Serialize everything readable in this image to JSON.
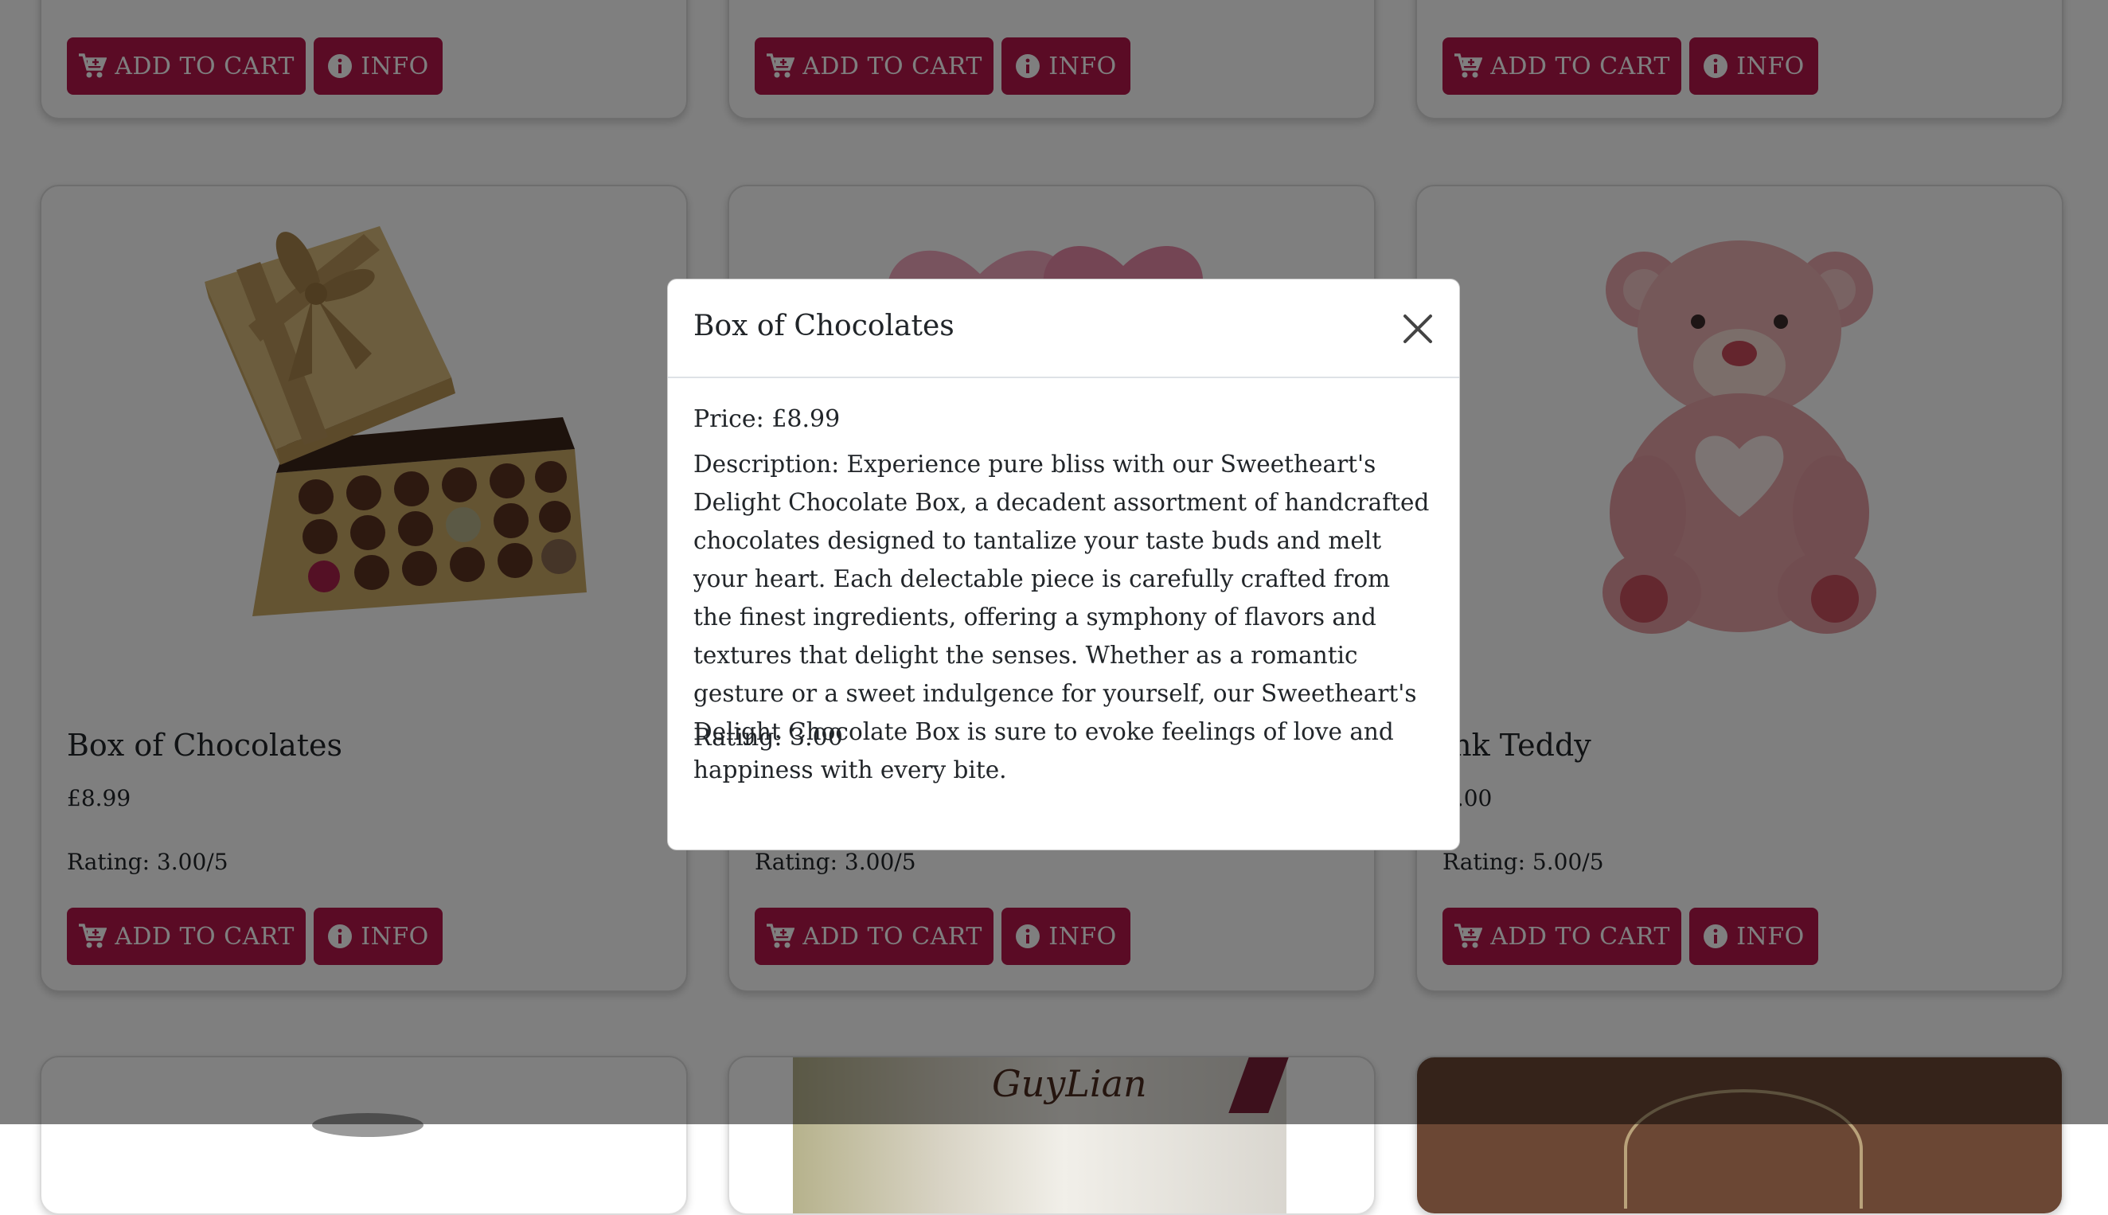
{
  "cards_top_row": [
    {
      "add_label": "ADD TO CART",
      "info_label": "INFO"
    },
    {
      "add_label": "ADD TO CART",
      "info_label": "INFO"
    },
    {
      "add_label": "ADD TO CART",
      "info_label": "INFO"
    }
  ],
  "cards_middle_row": [
    {
      "title": "Box of Chocolates",
      "price": "£8.99",
      "rating": "Rating: 3.00/5",
      "add_label": "ADD TO CART",
      "info_label": "INFO",
      "image": "box-of-chocolates-image"
    },
    {
      "title": "",
      "price": "",
      "rating": "Rating: 3.00/5",
      "add_label": "ADD TO CART",
      "info_label": "INFO",
      "image": "pink-hearts-image"
    },
    {
      "title": "ink Teddy",
      "price": "7.00",
      "rating": "Rating: 5.00/5",
      "add_label": "ADD TO CART",
      "info_label": "INFO",
      "image": "pink-teddy-bear-image"
    }
  ],
  "cards_bottom_row": [
    {
      "image": "product-image"
    },
    {
      "image": "guylian-chocolates-image",
      "logo_text": "GuyLian"
    },
    {
      "image": "product-image"
    }
  ],
  "modal": {
    "title": "Box of Chocolates",
    "price": "Price: £8.99",
    "description": "Description: Experience pure bliss with our Sweetheart's Delight Chocolate Box, a decadent assortment of handcrafted chocolates designed to tantalize your taste buds and melt your heart. Each delectable piece is carefully crafted from the finest ingredients, offering a symphony of flavors and textures that delight the senses. Whether as a romantic gesture or a sweet indulgence for yourself, our Sweetheart's Delight Chocolate Box is sure to evoke feelings of love and happiness with every bite.",
    "rating": "Rating: 3.00"
  },
  "colors": {
    "accent": "#b5174b",
    "overlay": "rgba(0,0,0,0.5)"
  },
  "icons": {
    "cart": "cart-plus-icon",
    "info": "info-circle-icon",
    "close": "close-icon"
  }
}
